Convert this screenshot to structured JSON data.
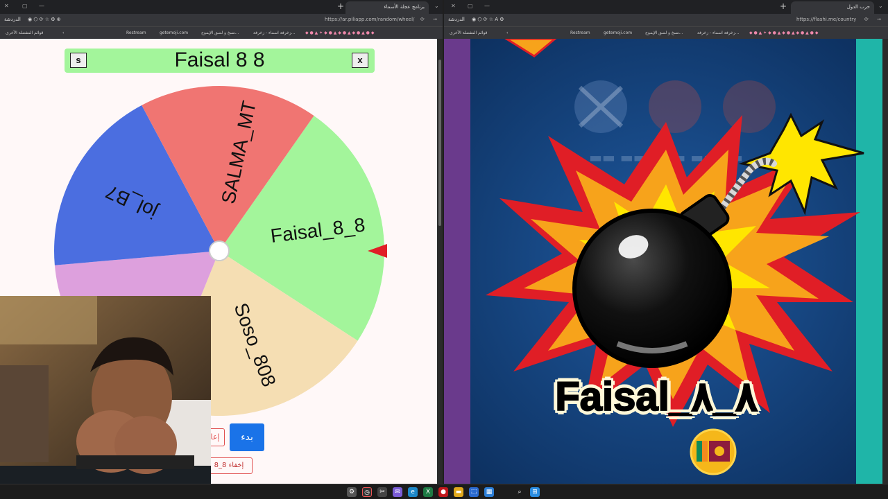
{
  "left_window": {
    "tab_title": "برنامج عجلة الأسماء",
    "url": "https://ar.piliapp.com/random/wheel/",
    "profile": "الدردشة",
    "bookmarks_folder": "قوائم المفضلة الأخرى",
    "bookmarks": [
      "Restream",
      "getemoji.com",
      "نسخ و لصق الإيموج...",
      "زخرفة اسماء - زخرفة..."
    ]
  },
  "right_window": {
    "tab_title": "حرب الدول",
    "url": "https://flashi.me/country",
    "profile": "الدردشة",
    "bookmarks_folder": "قوائم المفضلة الأخرى",
    "bookmarks": [
      "Restream",
      "getemoji.com",
      "نسخ و لصق الإيموج...",
      "زخرفة اسماء - زخرفة..."
    ]
  },
  "wheel_app": {
    "result_name": "Faisal  8  8",
    "left_button": "s",
    "close_button": "x",
    "slices": [
      {
        "label": "Faisal_8_8",
        "color": "#a3f59b"
      },
      {
        "label": "Soso_808",
        "color": "#f5deb3"
      },
      {
        "label": "",
        "color": "#dda0dd"
      },
      {
        "label": "jol_B7",
        "color": "#4b6ee0"
      },
      {
        "label": "SALMA_MT",
        "color": "#f07572"
      }
    ],
    "start_button": "بدء",
    "reset_button": "إعا",
    "hide_button": "إخفاء 8_8"
  },
  "game": {
    "player_name": "Faisal_٨_٨",
    "flag": "sri-lanka-flag"
  },
  "colors": {
    "game_background": "#0f3a6e",
    "burst_red": "#e01e26",
    "burst_orange": "#f7a31b",
    "burst_yellow": "#ffe600",
    "start_blue": "#1a73e8"
  },
  "taskbar_icons": [
    "settings-icon",
    "clock-icon",
    "screenshot-icon",
    "chat-icon",
    "edge-icon",
    "excel-icon",
    "record-icon",
    "folder-icon",
    "store-icon",
    "calendar-icon",
    "search-icon",
    "windows-icon"
  ]
}
